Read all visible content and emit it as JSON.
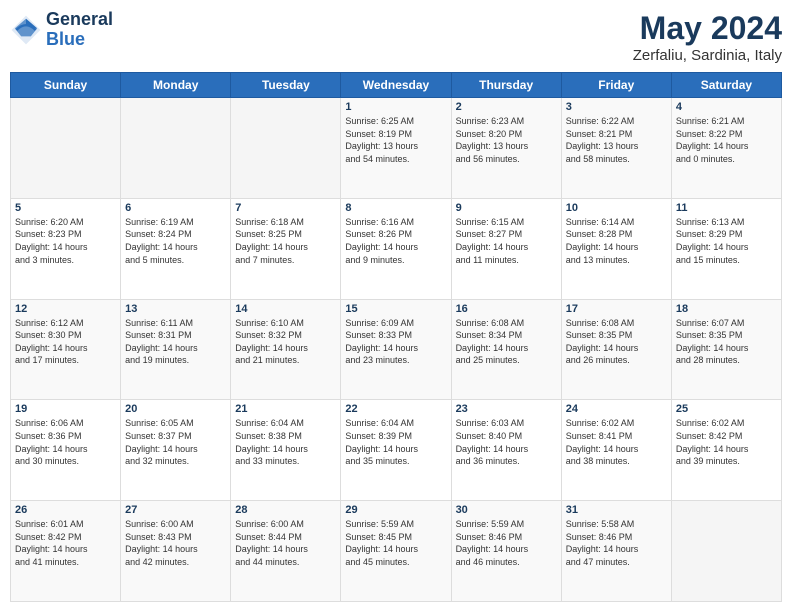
{
  "header": {
    "logo_line1": "General",
    "logo_line2": "Blue",
    "month_year": "May 2024",
    "location": "Zerfaliu, Sardinia, Italy"
  },
  "days_of_week": [
    "Sunday",
    "Monday",
    "Tuesday",
    "Wednesday",
    "Thursday",
    "Friday",
    "Saturday"
  ],
  "weeks": [
    [
      {
        "day": "",
        "sunrise": "",
        "sunset": "",
        "daylight": ""
      },
      {
        "day": "",
        "sunrise": "",
        "sunset": "",
        "daylight": ""
      },
      {
        "day": "",
        "sunrise": "",
        "sunset": "",
        "daylight": ""
      },
      {
        "day": "1",
        "sunrise": "Sunrise: 6:25 AM",
        "sunset": "Sunset: 8:19 PM",
        "daylight": "Daylight: 13 hours and 54 minutes."
      },
      {
        "day": "2",
        "sunrise": "Sunrise: 6:23 AM",
        "sunset": "Sunset: 8:20 PM",
        "daylight": "Daylight: 13 hours and 56 minutes."
      },
      {
        "day": "3",
        "sunrise": "Sunrise: 6:22 AM",
        "sunset": "Sunset: 8:21 PM",
        "daylight": "Daylight: 13 hours and 58 minutes."
      },
      {
        "day": "4",
        "sunrise": "Sunrise: 6:21 AM",
        "sunset": "Sunset: 8:22 PM",
        "daylight": "Daylight: 14 hours and 0 minutes."
      }
    ],
    [
      {
        "day": "5",
        "sunrise": "Sunrise: 6:20 AM",
        "sunset": "Sunset: 8:23 PM",
        "daylight": "Daylight: 14 hours and 3 minutes."
      },
      {
        "day": "6",
        "sunrise": "Sunrise: 6:19 AM",
        "sunset": "Sunset: 8:24 PM",
        "daylight": "Daylight: 14 hours and 5 minutes."
      },
      {
        "day": "7",
        "sunrise": "Sunrise: 6:18 AM",
        "sunset": "Sunset: 8:25 PM",
        "daylight": "Daylight: 14 hours and 7 minutes."
      },
      {
        "day": "8",
        "sunrise": "Sunrise: 6:16 AM",
        "sunset": "Sunset: 8:26 PM",
        "daylight": "Daylight: 14 hours and 9 minutes."
      },
      {
        "day": "9",
        "sunrise": "Sunrise: 6:15 AM",
        "sunset": "Sunset: 8:27 PM",
        "daylight": "Daylight: 14 hours and 11 minutes."
      },
      {
        "day": "10",
        "sunrise": "Sunrise: 6:14 AM",
        "sunset": "Sunset: 8:28 PM",
        "daylight": "Daylight: 14 hours and 13 minutes."
      },
      {
        "day": "11",
        "sunrise": "Sunrise: 6:13 AM",
        "sunset": "Sunset: 8:29 PM",
        "daylight": "Daylight: 14 hours and 15 minutes."
      }
    ],
    [
      {
        "day": "12",
        "sunrise": "Sunrise: 6:12 AM",
        "sunset": "Sunset: 8:30 PM",
        "daylight": "Daylight: 14 hours and 17 minutes."
      },
      {
        "day": "13",
        "sunrise": "Sunrise: 6:11 AM",
        "sunset": "Sunset: 8:31 PM",
        "daylight": "Daylight: 14 hours and 19 minutes."
      },
      {
        "day": "14",
        "sunrise": "Sunrise: 6:10 AM",
        "sunset": "Sunset: 8:32 PM",
        "daylight": "Daylight: 14 hours and 21 minutes."
      },
      {
        "day": "15",
        "sunrise": "Sunrise: 6:09 AM",
        "sunset": "Sunset: 8:33 PM",
        "daylight": "Daylight: 14 hours and 23 minutes."
      },
      {
        "day": "16",
        "sunrise": "Sunrise: 6:08 AM",
        "sunset": "Sunset: 8:34 PM",
        "daylight": "Daylight: 14 hours and 25 minutes."
      },
      {
        "day": "17",
        "sunrise": "Sunrise: 6:08 AM",
        "sunset": "Sunset: 8:35 PM",
        "daylight": "Daylight: 14 hours and 26 minutes."
      },
      {
        "day": "18",
        "sunrise": "Sunrise: 6:07 AM",
        "sunset": "Sunset: 8:35 PM",
        "daylight": "Daylight: 14 hours and 28 minutes."
      }
    ],
    [
      {
        "day": "19",
        "sunrise": "Sunrise: 6:06 AM",
        "sunset": "Sunset: 8:36 PM",
        "daylight": "Daylight: 14 hours and 30 minutes."
      },
      {
        "day": "20",
        "sunrise": "Sunrise: 6:05 AM",
        "sunset": "Sunset: 8:37 PM",
        "daylight": "Daylight: 14 hours and 32 minutes."
      },
      {
        "day": "21",
        "sunrise": "Sunrise: 6:04 AM",
        "sunset": "Sunset: 8:38 PM",
        "daylight": "Daylight: 14 hours and 33 minutes."
      },
      {
        "day": "22",
        "sunrise": "Sunrise: 6:04 AM",
        "sunset": "Sunset: 8:39 PM",
        "daylight": "Daylight: 14 hours and 35 minutes."
      },
      {
        "day": "23",
        "sunrise": "Sunrise: 6:03 AM",
        "sunset": "Sunset: 8:40 PM",
        "daylight": "Daylight: 14 hours and 36 minutes."
      },
      {
        "day": "24",
        "sunrise": "Sunrise: 6:02 AM",
        "sunset": "Sunset: 8:41 PM",
        "daylight": "Daylight: 14 hours and 38 minutes."
      },
      {
        "day": "25",
        "sunrise": "Sunrise: 6:02 AM",
        "sunset": "Sunset: 8:42 PM",
        "daylight": "Daylight: 14 hours and 39 minutes."
      }
    ],
    [
      {
        "day": "26",
        "sunrise": "Sunrise: 6:01 AM",
        "sunset": "Sunset: 8:42 PM",
        "daylight": "Daylight: 14 hours and 41 minutes."
      },
      {
        "day": "27",
        "sunrise": "Sunrise: 6:00 AM",
        "sunset": "Sunset: 8:43 PM",
        "daylight": "Daylight: 14 hours and 42 minutes."
      },
      {
        "day": "28",
        "sunrise": "Sunrise: 6:00 AM",
        "sunset": "Sunset: 8:44 PM",
        "daylight": "Daylight: 14 hours and 44 minutes."
      },
      {
        "day": "29",
        "sunrise": "Sunrise: 5:59 AM",
        "sunset": "Sunset: 8:45 PM",
        "daylight": "Daylight: 14 hours and 45 minutes."
      },
      {
        "day": "30",
        "sunrise": "Sunrise: 5:59 AM",
        "sunset": "Sunset: 8:46 PM",
        "daylight": "Daylight: 14 hours and 46 minutes."
      },
      {
        "day": "31",
        "sunrise": "Sunrise: 5:58 AM",
        "sunset": "Sunset: 8:46 PM",
        "daylight": "Daylight: 14 hours and 47 minutes."
      },
      {
        "day": "",
        "sunrise": "",
        "sunset": "",
        "daylight": ""
      }
    ]
  ]
}
